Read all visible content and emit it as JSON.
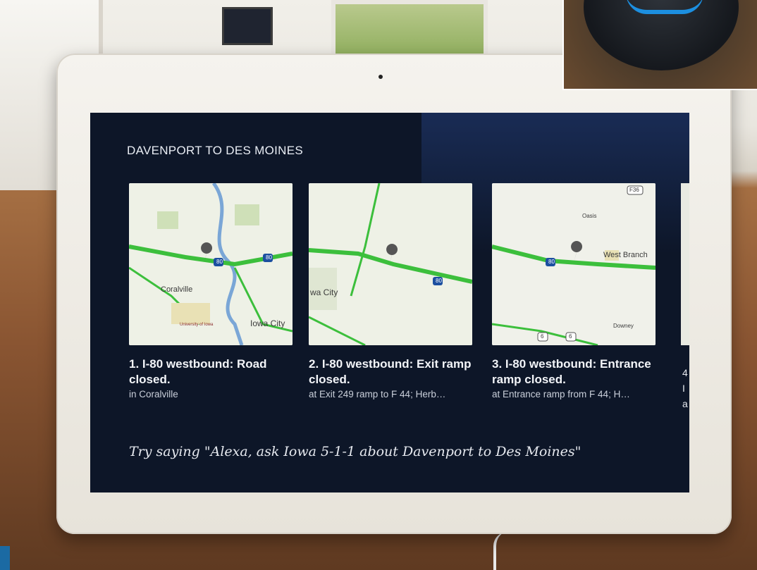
{
  "screen": {
    "route_title": "DAVENPORT TO DES MOINES",
    "cards": [
      {
        "headline": "1. I-80 westbound: Road closed.",
        "location": "in Coralville",
        "map_labels": [
          "Coralville",
          "Iowa City",
          "University of Iowa",
          "80",
          "80"
        ]
      },
      {
        "headline": "2. I-80 westbound: Exit ramp closed.",
        "location": "at Exit 249 ramp to F 44; Herb…",
        "map_labels": [
          "wa City",
          "80"
        ]
      },
      {
        "headline": "3. I-80 westbound: Entrance ramp closed.",
        "location": "at Entrance ramp from F 44; H…",
        "map_labels": [
          "West Branch",
          "80",
          "F36",
          "Oasis",
          "Downey",
          "6",
          "6"
        ]
      }
    ],
    "peek_card": {
      "line1": "4",
      "line2": "I",
      "line3": "a"
    },
    "hint": "Try saying \"Alexa, ask Iowa 5-1-1 about Davenport to Des Moines\""
  },
  "colors": {
    "screen_bg": "#0d1628",
    "road_closure": "#3cbf3c",
    "interstate_shield": "#1c4fa0",
    "echo_ring": "#1c8fe0"
  }
}
